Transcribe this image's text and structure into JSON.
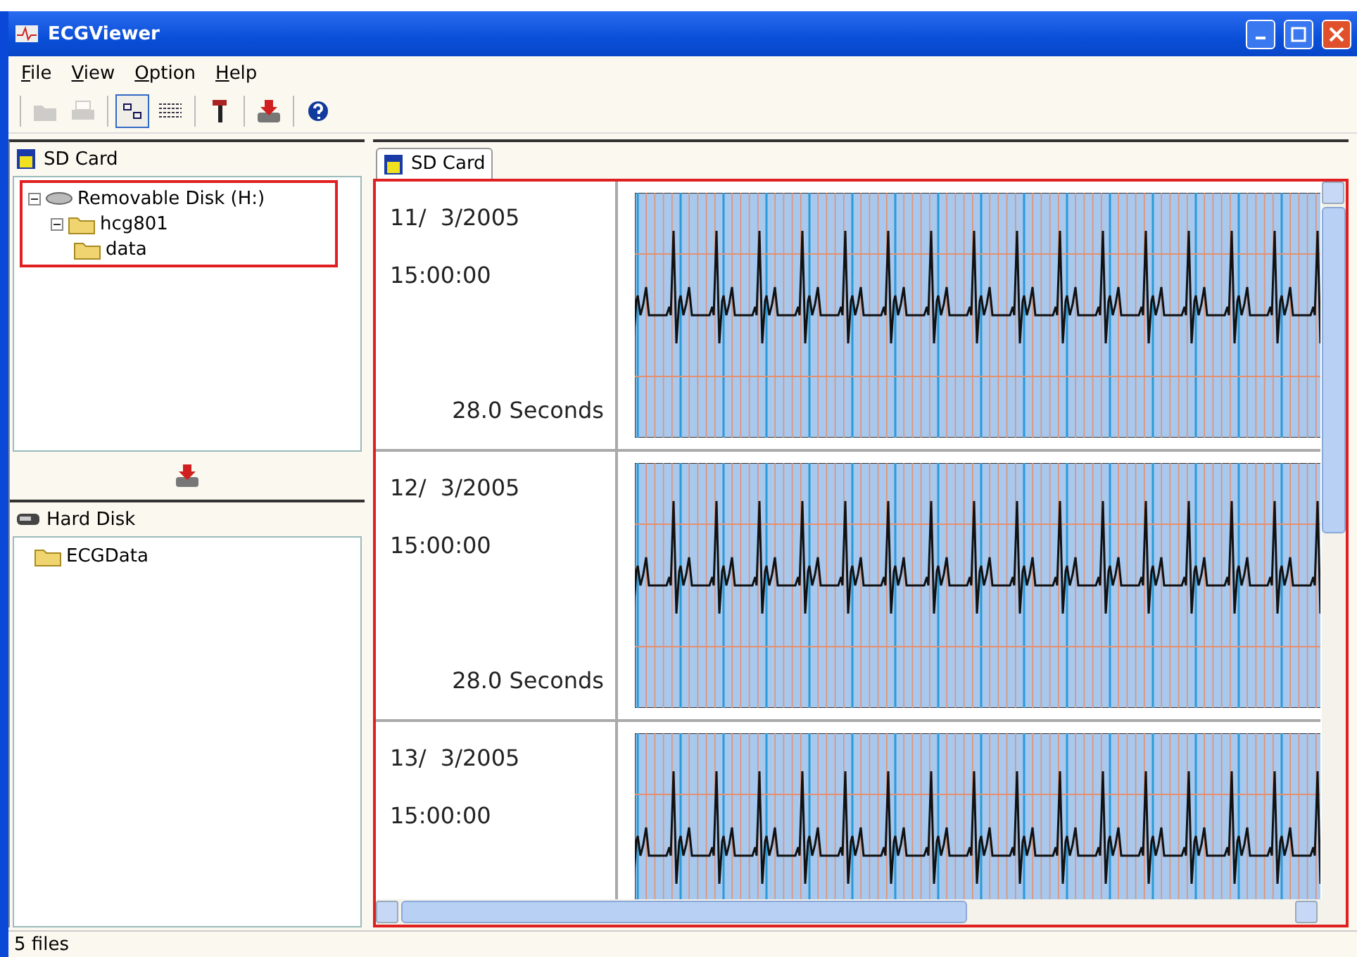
{
  "window": {
    "title": "ECGViewer"
  },
  "menu": [
    {
      "label": "File"
    },
    {
      "label": "View"
    },
    {
      "label": "Option"
    },
    {
      "label": "Help"
    }
  ],
  "toolbar": [
    {
      "kind": "open",
      "disabled": true,
      "pressed": false
    },
    {
      "kind": "print",
      "disabled": true,
      "pressed": false
    },
    {
      "kind": "thumbnails",
      "disabled": false,
      "pressed": true
    },
    {
      "kind": "list",
      "disabled": false,
      "pressed": false
    },
    {
      "kind": "tool",
      "disabled": false,
      "pressed": false
    },
    {
      "kind": "download",
      "disabled": false,
      "pressed": false
    },
    {
      "kind": "help",
      "disabled": false,
      "pressed": false
    }
  ],
  "sd_panel": {
    "title": "SD Card",
    "tree": [
      {
        "label": "Removable Disk (H:)",
        "kind": "drive",
        "expanded": true,
        "children": [
          {
            "label": "hcg801",
            "kind": "folder",
            "expanded": true,
            "children": [
              {
                "label": "data",
                "kind": "folder"
              }
            ]
          }
        ]
      }
    ]
  },
  "hd_panel": {
    "title": "Hard Disk",
    "tree": [
      {
        "label": "ECGData",
        "kind": "folder"
      }
    ]
  },
  "tabs": [
    {
      "label": "SD Card",
      "selected": true
    }
  ],
  "records": [
    {
      "date": "11/  3/2005",
      "time": "15:00:00",
      "duration": "28.0 Seconds"
    },
    {
      "date": "12/  3/2005",
      "time": "15:00:00",
      "duration": "28.0 Seconds"
    },
    {
      "date": "13/  3/2005",
      "time": "15:00:00"
    }
  ],
  "status_bar": {
    "text": "5 files"
  }
}
